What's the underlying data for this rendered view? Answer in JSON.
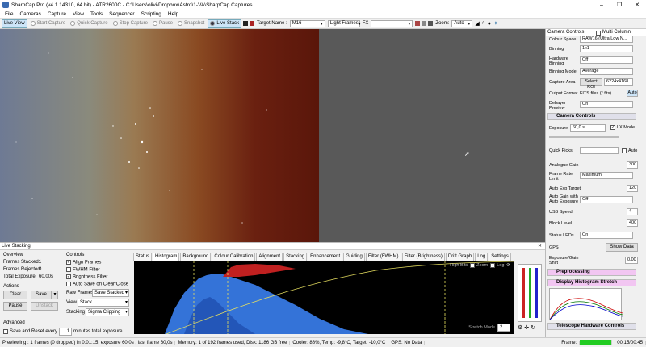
{
  "window": {
    "title": "SharpCap Pro (v4.1.14310, 64 bit) - ATR2600C - C:\\Users\\olivi\\Dropbox\\Astro\\1-VA\\SharpCap Captures"
  },
  "menu": [
    "File",
    "Cameras",
    "Capture",
    "View",
    "Tools",
    "Sequencer",
    "Scripting",
    "Help"
  ],
  "toolbar": {
    "live_view": "Live View",
    "start_capture": "Start Capture",
    "quick_capture": "Quick Capture",
    "stop_capture": "Stop Capture",
    "pause": "Pause",
    "snapshot": "Snapshot",
    "live_stack": "Live Stack",
    "target_label": "Target Name :",
    "target_value": "M16",
    "frame_type": "Light Frames",
    "fx_label": "FX",
    "zoom_label": "Zoom:",
    "zoom_value": "Auto"
  },
  "live_stacking": {
    "title": "Live Stacking",
    "overview_label": "Overview",
    "frames_stacked_label": "Frames Stacked:",
    "frames_stacked": "1",
    "frames_rejected_label": "Frames Rejected:",
    "frames_rejected": "0",
    "total_exposure_label": "Total Exposure:",
    "total_exposure": "60,00s",
    "actions_label": "Actions",
    "clear": "Clear",
    "save": "Save",
    "pause": "Pause",
    "unstack": "Unstack",
    "advanced_label": "Advanced",
    "save_reset_label": "Save and Reset every",
    "save_reset_value": "1",
    "minutes_label": "minutes total exposure",
    "controls_label": "Controls",
    "align_frames": "Align Frames",
    "fwhm_filter": "FWHM Filter",
    "brightness_filter": "Brightness Filter",
    "auto_save": "Auto Save on Clear/Close",
    "raw_frames_label": "Raw Frames",
    "raw_frames_value": "Save Stacked",
    "view_label": "View",
    "view_value": "Stack",
    "stacking_label": "Stacking",
    "stacking_value": "Sigma Clipping"
  },
  "tabs": [
    "Status",
    "Histogram",
    "Background",
    "Colour Calibration",
    "Alignment",
    "Stacking",
    "Enhancement",
    "Guiding",
    "Filter (FWHM)",
    "Filter (Brightness)",
    "Drift Graph",
    "Log",
    "Settings"
  ],
  "histogram": {
    "high_bits": "High Bits",
    "zoom": "Zoom",
    "log": "Log",
    "stretch_mode": "Stretch Mode",
    "stretch_value": "2"
  },
  "camera_controls": {
    "title": "Camera Controls",
    "multi_column": "Multi Column",
    "colour_space_label": "Colour Space",
    "colour_space": "RAW16 (Ultra Low N...",
    "binning_label": "Binning",
    "binning": "1x1",
    "hw_binning_label": "Hardware Binning",
    "hw_binning": "Off",
    "binning_mode_label": "Binning Mode",
    "binning_mode": "Average",
    "capture_area_label": "Capture Area",
    "select_roi": "Select ROI",
    "capture_area": "6224x4168",
    "output_format_label": "Output Format",
    "output_format": "FITS files (*.fits)",
    "auto": "Auto",
    "debayer_label": "Debayer Preview",
    "debayer": "On",
    "section_camera": "Camera Controls",
    "exposure_label": "Exposure",
    "exposure": "60,0 s",
    "lx_mode": "LX Mode",
    "quick_picks_label": "Quick Picks",
    "auto_chk": "Auto",
    "analogue_gain_label": "Analogue Gain",
    "analogue_gain": "300",
    "frame_rate_label": "Frame Rate Limit",
    "frame_rate": "Maximum",
    "auto_exp_label": "Auto Exp Target",
    "auto_exp": "120",
    "auto_gain_label": "Auto Gain with Auto Exposure",
    "auto_gain": "Off",
    "usb_speed_label": "USB Speed",
    "usb_speed": "4",
    "block_level_label": "Block Level",
    "block_level": "400",
    "status_leds_label": "Status LEDs",
    "status_leds": "On",
    "gps_label": "GPS",
    "show_data": "Show Data",
    "exp_gain_shift_label": "Exposure/Gain Shift",
    "exp_gain_shift": "0.00",
    "section_preprocessing": "Preprocessing",
    "section_histogram": "Display Histogram Stretch",
    "section_telescope": "Telescope Hardware Controls"
  },
  "status": {
    "main": "Previewing : 1 frames (0 dropped) in 0:01:15, exposure 60,0s , last frame 60,0s",
    "memory": "Memory: 1 of 192 frames used, Disk: 1186 GB free",
    "cooler": "Cooler: 88%, Temp: -9,8°C, Target: -10,0°C",
    "gps": "GPS: No Data",
    "frame_label": "Frame:",
    "time": "00:15/00:45"
  },
  "colors": {
    "accent": "#0078d7",
    "histogram_blue": "#3a7ff0",
    "histogram_red": "#c02020",
    "image_left": "#6e7a94",
    "image_right": "#5a160a"
  }
}
